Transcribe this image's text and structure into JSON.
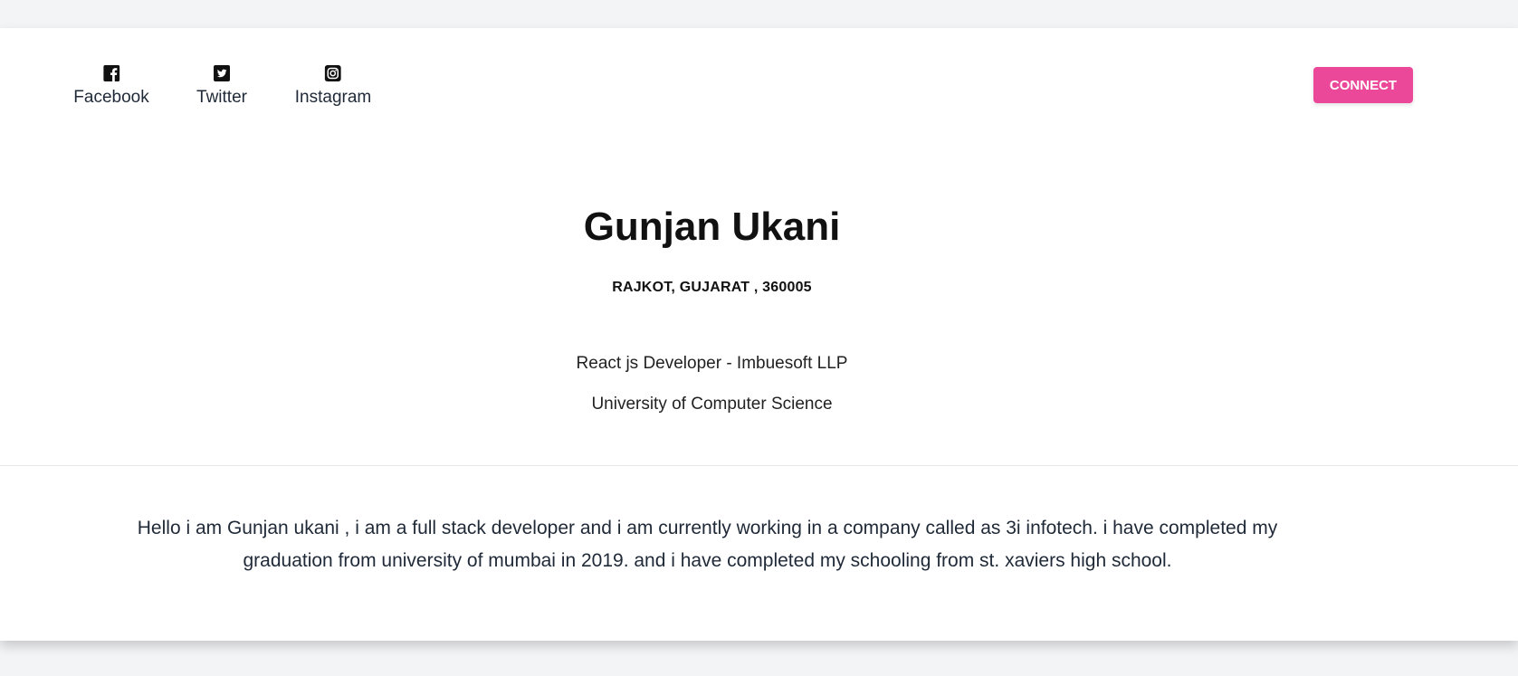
{
  "social_links": [
    {
      "label": "Facebook",
      "icon": "facebook-icon"
    },
    {
      "label": "Twitter",
      "icon": "twitter-icon"
    },
    {
      "label": "Instagram",
      "icon": "instagram-icon"
    }
  ],
  "connect_button": {
    "label": "CONNECT",
    "color": "#ec4899"
  },
  "profile": {
    "name": "Gunjan Ukani",
    "location": "RAJKOT, GUJARAT , 360005",
    "job": "React js Developer - Imbuesoft LLP",
    "education": "University of Computer Science"
  },
  "bio": "Hello i am Gunjan ukani , i am a full stack developer and i am currently working in a company called as 3i infotech. i have completed my graduation from university of mumbai in 2019. and i have completed my schooling from st. xaviers high school."
}
